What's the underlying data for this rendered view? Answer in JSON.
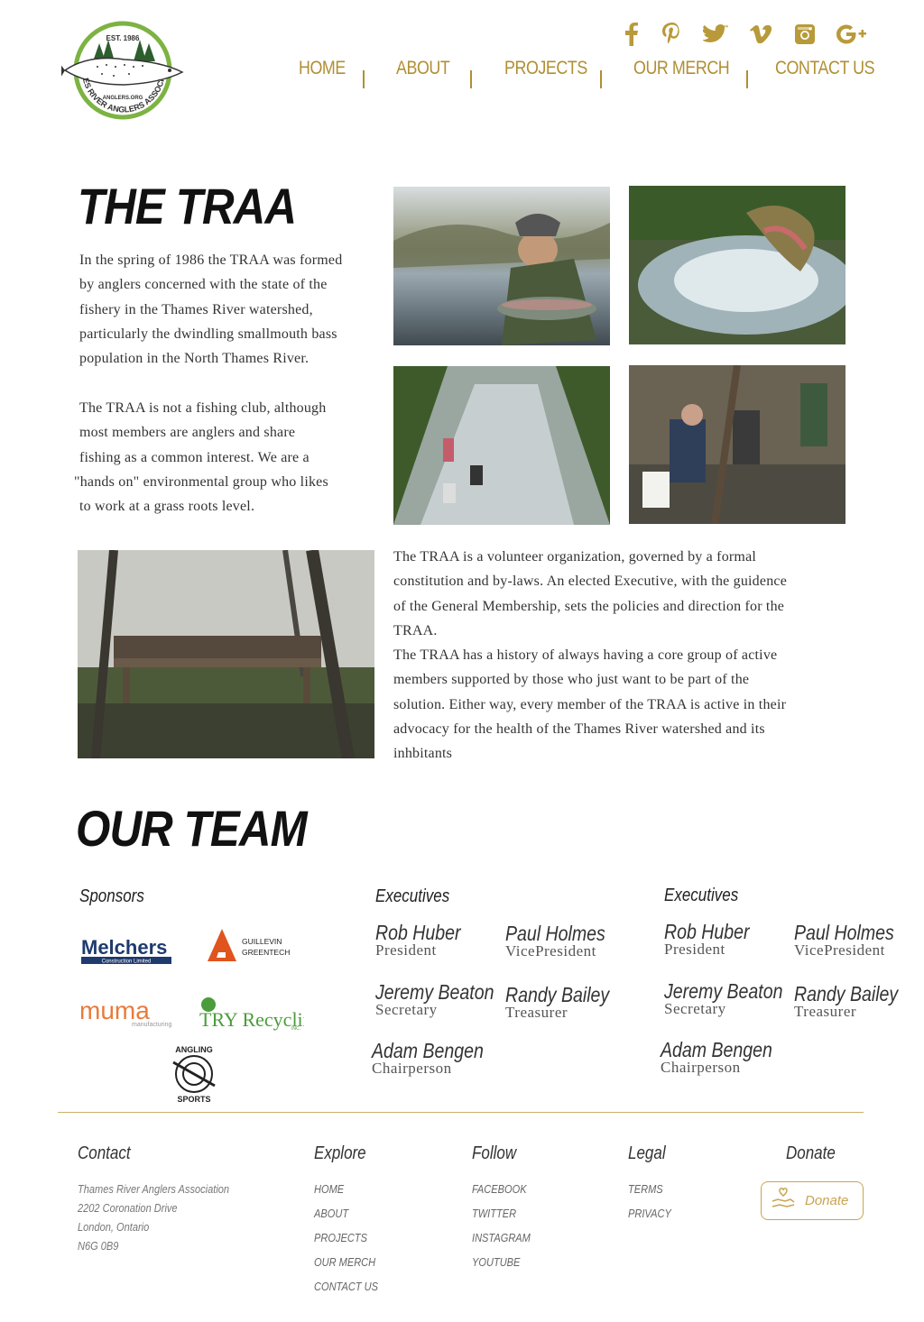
{
  "header": {
    "logo": {
      "est": "EST. 1986",
      "site": "ANGLERS.ORG",
      "org_ring": "THAMES RIVER ANGLERS ASSOCIATION"
    },
    "social_icons": [
      "facebook-icon",
      "pinterest-icon",
      "twitter-icon",
      "vimeo-icon",
      "instagram-icon",
      "google-plus-icon"
    ],
    "nav": [
      {
        "label": "HOME"
      },
      {
        "label": "ABOUT"
      },
      {
        "label": "PROJECTS"
      },
      {
        "label": "OUR MERCH"
      },
      {
        "label": "CONTACT US"
      }
    ],
    "nav_separator": "|"
  },
  "about": {
    "title": "THE TRAA",
    "paragraph_1": [
      "In the spring of 1986 the TRAA was formed",
      "by anglers concerned with the state of the",
      "fishery in the Thames River watershed,",
      "particularly the dwindling smallmouth bass",
      "population in the North Thames River."
    ],
    "paragraph_2": [
      "The TRAA is not a fishing club, although",
      "most members are anglers and share",
      "fishing as a common interest. We are a",
      "\"hands on\" environmental group who likes",
      "to work at a grass roots level."
    ],
    "paragraph_3": [
      "The TRAA is a volunteer organization, governed by a formal",
      "constitution and by-laws. An elected Executive, with the guidence",
      "of the General Membership, sets the policies and direction for the",
      "TRAA.",
      "The TRAA has a history of always having a core group of active",
      "members supported by those who just want to be part of the",
      "solution. Either way, every member of the TRAA is active in their",
      "advocacy for the health of the Thames River watershed and its",
      "inhbitants"
    ]
  },
  "team": {
    "title": "OUR TEAM",
    "sponsors": {
      "heading": "Sponsors",
      "logos": [
        {
          "name": "Melchers",
          "sub": "Construction Limited"
        },
        {
          "name": "GUILLEVIN",
          "sub": "GREENTECH"
        },
        {
          "name": "muma",
          "sub": "manufacturing"
        },
        {
          "name": "TRY Recycling",
          "sub": "INC."
        },
        {
          "name": "ANGLING",
          "sub": "SPORTS"
        }
      ]
    },
    "executive_groups": [
      {
        "heading": "Executives",
        "members": [
          {
            "name": "Rob Huber",
            "role": "President"
          },
          {
            "name": "Paul Holmes",
            "role": "VicePresident"
          },
          {
            "name": "Jeremy Beaton",
            "role": "Secretary"
          },
          {
            "name": "Randy Bailey",
            "role": "Treasurer"
          },
          {
            "name": "Adam Bengen",
            "role": "Chairperson"
          }
        ]
      },
      {
        "heading": "Executives",
        "members": [
          {
            "name": "Rob Huber",
            "role": "President"
          },
          {
            "name": "Paul Holmes",
            "role": "VicePresident"
          },
          {
            "name": "Jeremy Beaton",
            "role": "Secretary"
          },
          {
            "name": "Randy Bailey",
            "role": "Treasurer"
          },
          {
            "name": "Adam Bengen",
            "role": "Chairperson"
          }
        ]
      }
    ]
  },
  "footer": {
    "contact": {
      "heading": "Contact",
      "lines": [
        "Thames River Anglers Association",
        "2202 Coronation Drive",
        "London, Ontario",
        "N6G 0B9"
      ]
    },
    "explore": {
      "heading": "Explore",
      "links": [
        "HOME",
        "ABOUT",
        "PROJECTS",
        "OUR MERCH",
        "CONTACT US"
      ]
    },
    "follow": {
      "heading": "Follow",
      "links": [
        "FACEBOOK",
        "TWITTER",
        "INSTAGRAM",
        "YOUTUBE"
      ]
    },
    "legal": {
      "heading": "Legal",
      "links": [
        "TERMS",
        "PRIVACY"
      ]
    },
    "donate": {
      "heading": "Donate",
      "button_label": "Donate"
    }
  },
  "colors": {
    "accent_gold": "#b08f33",
    "logo_green": "#7cb342",
    "footer_rule": "#c9b06a"
  }
}
